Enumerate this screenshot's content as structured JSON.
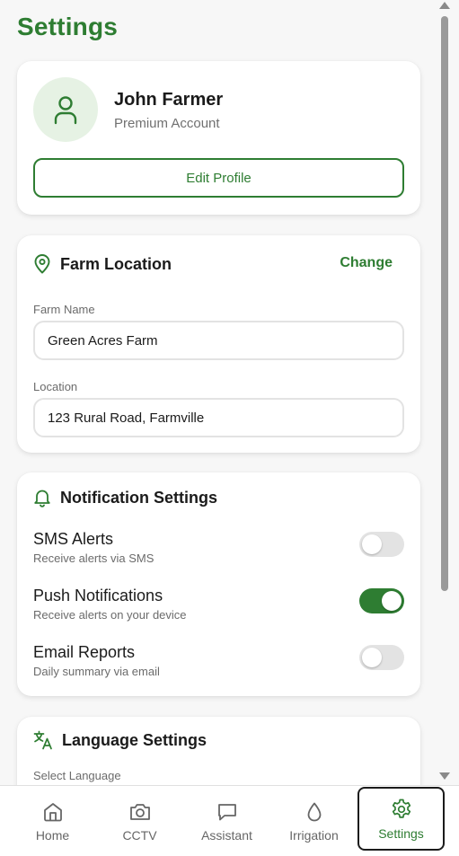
{
  "page": {
    "title": "Settings"
  },
  "profile": {
    "name": "John Farmer",
    "account_type": "Premium Account",
    "edit_label": "Edit Profile"
  },
  "farm_location": {
    "title": "Farm Location",
    "change_label": "Change",
    "farm_name_label": "Farm Name",
    "farm_name_value": "Green Acres Farm",
    "location_label": "Location",
    "location_value": "123 Rural Road, Farmville"
  },
  "notifications": {
    "title": "Notification Settings",
    "items": [
      {
        "title": "SMS Alerts",
        "desc": "Receive alerts via SMS",
        "enabled": false
      },
      {
        "title": "Push Notifications",
        "desc": "Receive alerts on your device",
        "enabled": true
      },
      {
        "title": "Email Reports",
        "desc": "Daily summary via email",
        "enabled": false
      }
    ]
  },
  "language": {
    "title": "Language Settings",
    "select_label": "Select Language"
  },
  "bottom_nav": {
    "items": [
      {
        "label": "Home",
        "icon": "home-icon"
      },
      {
        "label": "CCTV",
        "icon": "camera-icon"
      },
      {
        "label": "Assistant",
        "icon": "chat-icon"
      },
      {
        "label": "Irrigation",
        "icon": "droplet-icon"
      },
      {
        "label": "Settings",
        "icon": "gear-icon"
      }
    ],
    "active": "Settings"
  },
  "colors": {
    "accent": "#2e7d32",
    "avatar_bg": "#e6f2e4",
    "muted_text": "#6b6b6b",
    "toggle_off": "#e3e3e3"
  }
}
